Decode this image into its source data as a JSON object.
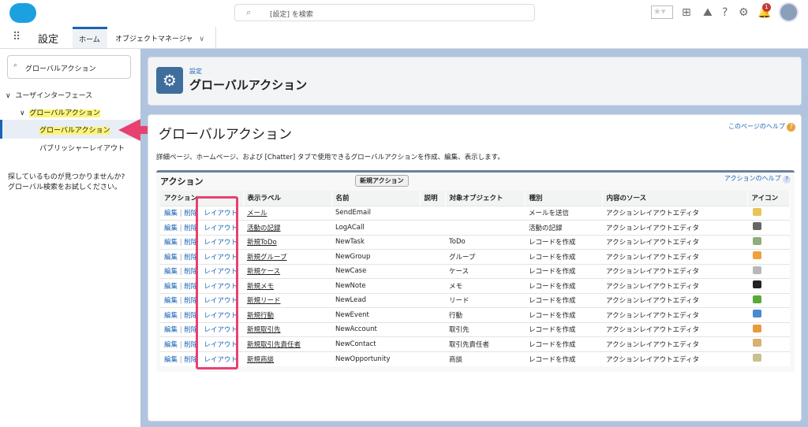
{
  "header": {
    "search_placeholder": "[設定] を検索",
    "notification_count": "1"
  },
  "nav": {
    "app_title": "設定",
    "tabs": [
      {
        "label": "ホーム"
      },
      {
        "label": "オブジェクトマネージャ"
      }
    ]
  },
  "sidebar": {
    "search_value": "グローバルアクション",
    "tree": [
      {
        "label": "ユーザインターフェース"
      },
      {
        "label": "グローバルアクション"
      },
      {
        "label": "グローバルアクション"
      },
      {
        "label": "パブリッシャーレイアウト"
      }
    ],
    "not_found": "探しているものが見つかりませんか?",
    "global_search_hint": "グローバル検索をお試しください。"
  },
  "page_header": {
    "breadcrumb": "設定",
    "title": "グローバルアクション"
  },
  "content": {
    "title": "グローバルアクション",
    "help_link": "このページのヘルプ",
    "description": "詳細ページ、ホームページ、および [Chatter] タブで使用できるグローバルアクションを作成、編集、表示します。",
    "section_title": "アクション",
    "new_button": "新規アクション",
    "section_help": "アクションのヘルプ",
    "columns": [
      "アクション",
      "表示ラベル",
      "名前",
      "説明",
      "対象オブジェクト",
      "種別",
      "内容のソース",
      "アイコン"
    ],
    "row_links": {
      "edit": "編集",
      "sep": "|",
      "delete": "削除",
      "layout": "レイアウト"
    },
    "rows": [
      {
        "label": "メール",
        "name": "SendEmail",
        "object": "",
        "type": "メールを送信",
        "source": "アクションレイアウトエディタ",
        "icon": "email-icon",
        "color": "#e8c35a"
      },
      {
        "label": "活動の記録",
        "name": "LogACall",
        "object": "",
        "type": "活動の記録",
        "source": "アクションレイアウトエディタ",
        "icon": "phone-icon",
        "color": "#666666"
      },
      {
        "label": "新規ToDo",
        "name": "NewTask",
        "object": "ToDo",
        "type": "レコードを作成",
        "source": "アクションレイアウトエディタ",
        "icon": "task-icon",
        "color": "#8fae7a"
      },
      {
        "label": "新規グループ",
        "name": "NewGroup",
        "object": "グループ",
        "type": "レコードを作成",
        "source": "アクションレイアウトエディタ",
        "icon": "group-icon",
        "color": "#f0a040"
      },
      {
        "label": "新規ケース",
        "name": "NewCase",
        "object": "ケース",
        "type": "レコードを作成",
        "source": "アクションレイアウトエディタ",
        "icon": "case-icon",
        "color": "#b8b8b8"
      },
      {
        "label": "新規メモ",
        "name": "NewNote",
        "object": "メモ",
        "type": "レコードを作成",
        "source": "アクションレイアウトエディタ",
        "icon": "note-icon",
        "color": "#222222"
      },
      {
        "label": "新規リード",
        "name": "NewLead",
        "object": "リード",
        "type": "レコードを作成",
        "source": "アクションレイアウトエディタ",
        "icon": "lead-icon",
        "color": "#5aa83a"
      },
      {
        "label": "新規行動",
        "name": "NewEvent",
        "object": "行動",
        "type": "レコードを作成",
        "source": "アクションレイアウトエディタ",
        "icon": "event-icon",
        "color": "#4a8ad0"
      },
      {
        "label": "新規取引先",
        "name": "NewAccount",
        "object": "取引先",
        "type": "レコードを作成",
        "source": "アクションレイアウトエディタ",
        "icon": "account-icon",
        "color": "#e89a40"
      },
      {
        "label": "新規取引先責任者",
        "name": "NewContact",
        "object": "取引先責任者",
        "type": "レコードを作成",
        "source": "アクションレイアウトエディタ",
        "icon": "contact-icon",
        "color": "#d8b070"
      },
      {
        "label": "新規商談",
        "name": "NewOpportunity",
        "object": "商談",
        "type": "レコードを作成",
        "source": "アクションレイアウトエディタ",
        "icon": "opportunity-icon",
        "color": "#c8c090"
      }
    ]
  },
  "colors": {
    "highlight": "#e8416f",
    "brand": "#1ba1e0"
  }
}
